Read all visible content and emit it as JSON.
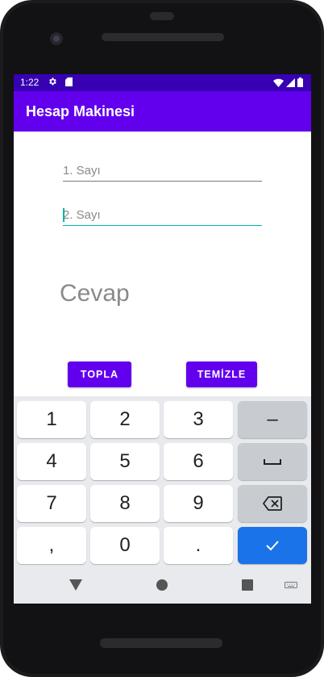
{
  "status_bar": {
    "time": "1:22"
  },
  "app_bar": {
    "title": "Hesap Makinesi"
  },
  "form": {
    "first_number_placeholder": "1. Sayı",
    "second_number_placeholder": "2. Sayı",
    "answer": "Cevap"
  },
  "buttons": {
    "add": "TOPLA",
    "clear": "TEMİZLE"
  },
  "keyboard": {
    "rows": [
      [
        "1",
        "2",
        "3",
        "–"
      ],
      [
        "4",
        "5",
        "6",
        "space-icon"
      ],
      [
        "7",
        "8",
        "9",
        "backspace-icon"
      ],
      [
        ",",
        "0",
        ".",
        "check-icon"
      ]
    ]
  },
  "colors": {
    "primary": "#6200ee",
    "primary_dark": "#3700b3",
    "accent": "#03b2a5",
    "keyboard_done": "#1a73e8"
  },
  "icons": [
    "settings-icon",
    "sd-card-icon",
    "wifi-icon",
    "signal-icon",
    "battery-icon",
    "back-icon",
    "home-icon",
    "recents-icon",
    "keyboard-switch-icon"
  ]
}
